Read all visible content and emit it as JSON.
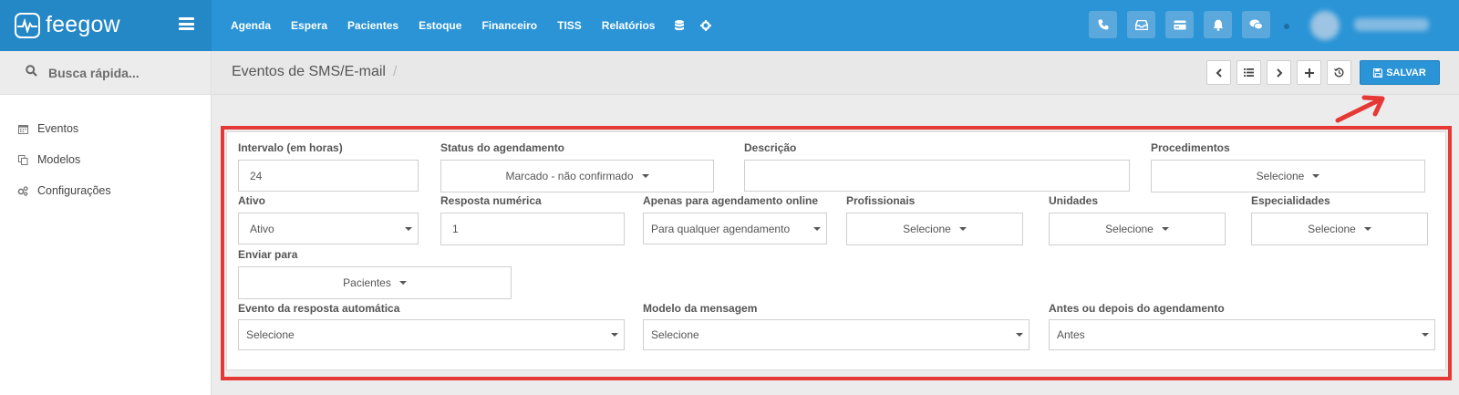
{
  "brand": {
    "name": "feegow"
  },
  "nav": [
    "Agenda",
    "Espera",
    "Pacientes",
    "Estoque",
    "Financeiro",
    "TISS",
    "Relatórios"
  ],
  "nav_icons": [
    "database-icon",
    "gear-icon"
  ],
  "top_actions": [
    "phone-icon",
    "inbox-icon",
    "card-icon",
    "bell-icon",
    "chat-icon"
  ],
  "sidebar": {
    "search_placeholder": "Busca rápida...",
    "items": [
      {
        "label": "Eventos",
        "icon": "calendar-icon"
      },
      {
        "label": "Modelos",
        "icon": "copy-icon"
      },
      {
        "label": "Configurações",
        "icon": "cogs-icon"
      }
    ]
  },
  "header": {
    "title": "Eventos de SMS/E-mail",
    "separator": "/",
    "save_label": "SALVAR"
  },
  "toolbar": [
    "prev-icon",
    "list-icon",
    "next-icon",
    "plus-icon",
    "history-icon"
  ],
  "form": {
    "intervalo": {
      "label": "Intervalo (em horas)",
      "value": "24"
    },
    "status": {
      "label": "Status do agendamento",
      "value": "Marcado - não confirmado"
    },
    "descricao": {
      "label": "Descrição",
      "value": ""
    },
    "procedimentos": {
      "label": "Procedimentos",
      "value": "Selecione"
    },
    "ativo": {
      "label": "Ativo",
      "value": "Ativo"
    },
    "resposta": {
      "label": "Resposta numérica",
      "value": "1"
    },
    "online": {
      "label": "Apenas para agendamento online",
      "value": "Para qualquer agendamento"
    },
    "profissionais": {
      "label": "Profissionais",
      "value": "Selecione"
    },
    "unidades": {
      "label": "Unidades",
      "value": "Selecione"
    },
    "especialidades": {
      "label": "Especialidades",
      "value": "Selecione"
    },
    "enviar": {
      "label": "Enviar para",
      "value": "Pacientes"
    },
    "evento_auto": {
      "label": "Evento da resposta automática",
      "value": "Selecione"
    },
    "modelo": {
      "label": "Modelo da mensagem",
      "value": "Selecione"
    },
    "antes_depois": {
      "label": "Antes ou depois do agendamento",
      "value": "Antes"
    }
  },
  "colors": {
    "primary": "#2a94d6",
    "highlight": "#e53935"
  }
}
